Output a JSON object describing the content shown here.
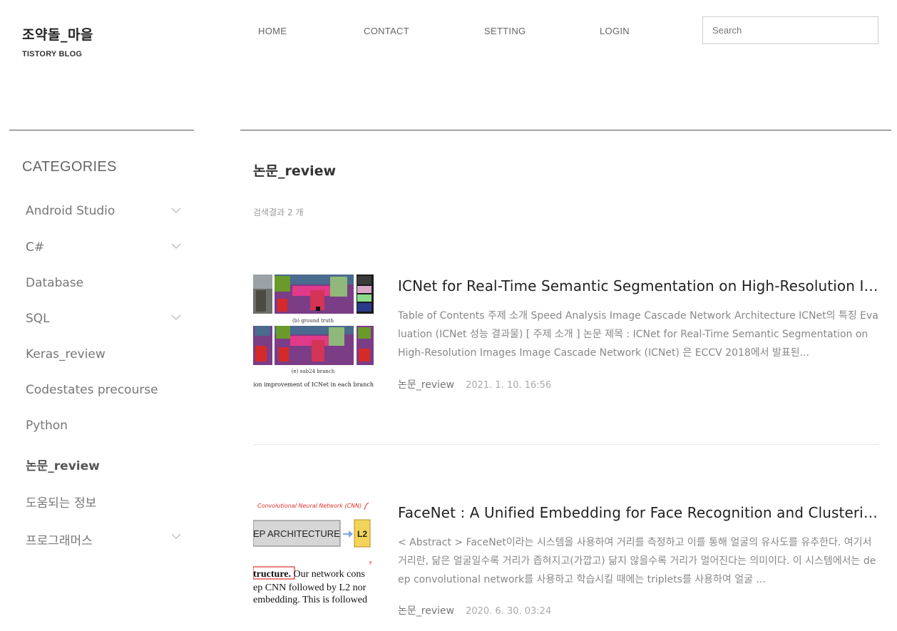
{
  "blog": {
    "title": "조약돌_마을",
    "subtitle": "TISTORY BLOG"
  },
  "nav": {
    "items": [
      {
        "label": "HOME"
      },
      {
        "label": "CONTACT"
      },
      {
        "label": "SETTING"
      },
      {
        "label": "LOGIN"
      }
    ]
  },
  "search": {
    "placeholder": "Search",
    "value": ""
  },
  "sidebar": {
    "heading": "CATEGORIES",
    "items": [
      {
        "label": "Android Studio",
        "expandable": true
      },
      {
        "label": "C#",
        "expandable": true
      },
      {
        "label": "Database",
        "expandable": false
      },
      {
        "label": "SQL",
        "expandable": true
      },
      {
        "label": "Keras_review",
        "expandable": false
      },
      {
        "label": "Codestates precourse",
        "expandable": false
      },
      {
        "label": "Python",
        "expandable": false
      },
      {
        "label": "논문_review",
        "expandable": false,
        "active": true
      },
      {
        "label": "도움되는 정보",
        "expandable": false
      },
      {
        "label": "프로그래머스",
        "expandable": true
      }
    ]
  },
  "main": {
    "title": "논문_review",
    "result_count": "검색결과 2 개",
    "posts": [
      {
        "title": "ICNet for Real-Time Semantic Segmentation on High-Resolution Images",
        "excerpt": "Table of Contents 주제 소개 Speed Analysis Image Cascade Network Architecture ICNet의 특징 Evaluation (ICNet 성능 결과물) [ 주제 소개 ] 논문 제목 : ICNet for Real-Time Semantic Segmentation on High-Resolution Images Image Cascade Network (ICNet) 은 ECCV 2018에서 발표된...",
        "category": "논문_review",
        "date": "2021. 1. 10. 16:56",
        "thumb_caption_1": "(b) ground truth",
        "thumb_caption_2": "(e) sub24 branch",
        "thumb_caption_3": "ion improvement of ICNet in each branch"
      },
      {
        "title": "FaceNet : A Unified Embedding for Face Recognition and Clustering",
        "excerpt": "< Abstract > FaceNet이라는 시스템을 사용하여 거리를 측정하고 이를 통해 얼굴의 유사도를 유추한다. 여기서 거리란, 닮은 얼굴일수록 거리가 좁혀지고(가깝고) 닮지 않을수록 거리가 멀어진다는 의미이다. 이 시스템에서는 deep convolutional network를 사용하고 학습시킬 때에는 triplets를 사용하여 얼굴 ...",
        "category": "논문_review",
        "date": "2020. 6. 30. 03:24",
        "thumb_handwritten": "Convolutional Neural Network (CNN)",
        "thumb_box": "EP ARCHITECTURE",
        "thumb_l2": "L2",
        "thumb_line_1": "tructure.",
        "thumb_line_1b": " Our network cons",
        "thumb_line_2": "ep CNN followed by L2 nor",
        "thumb_line_3": "embedding. This is followed"
      }
    ]
  },
  "colors": {
    "chevron": "#bbbbbb",
    "rule": "#555555",
    "thumb_red_annotation": "#e0302a",
    "thumb_yellow": "#f3d45a",
    "thumb_blue_arrow": "#7aa7e0"
  }
}
